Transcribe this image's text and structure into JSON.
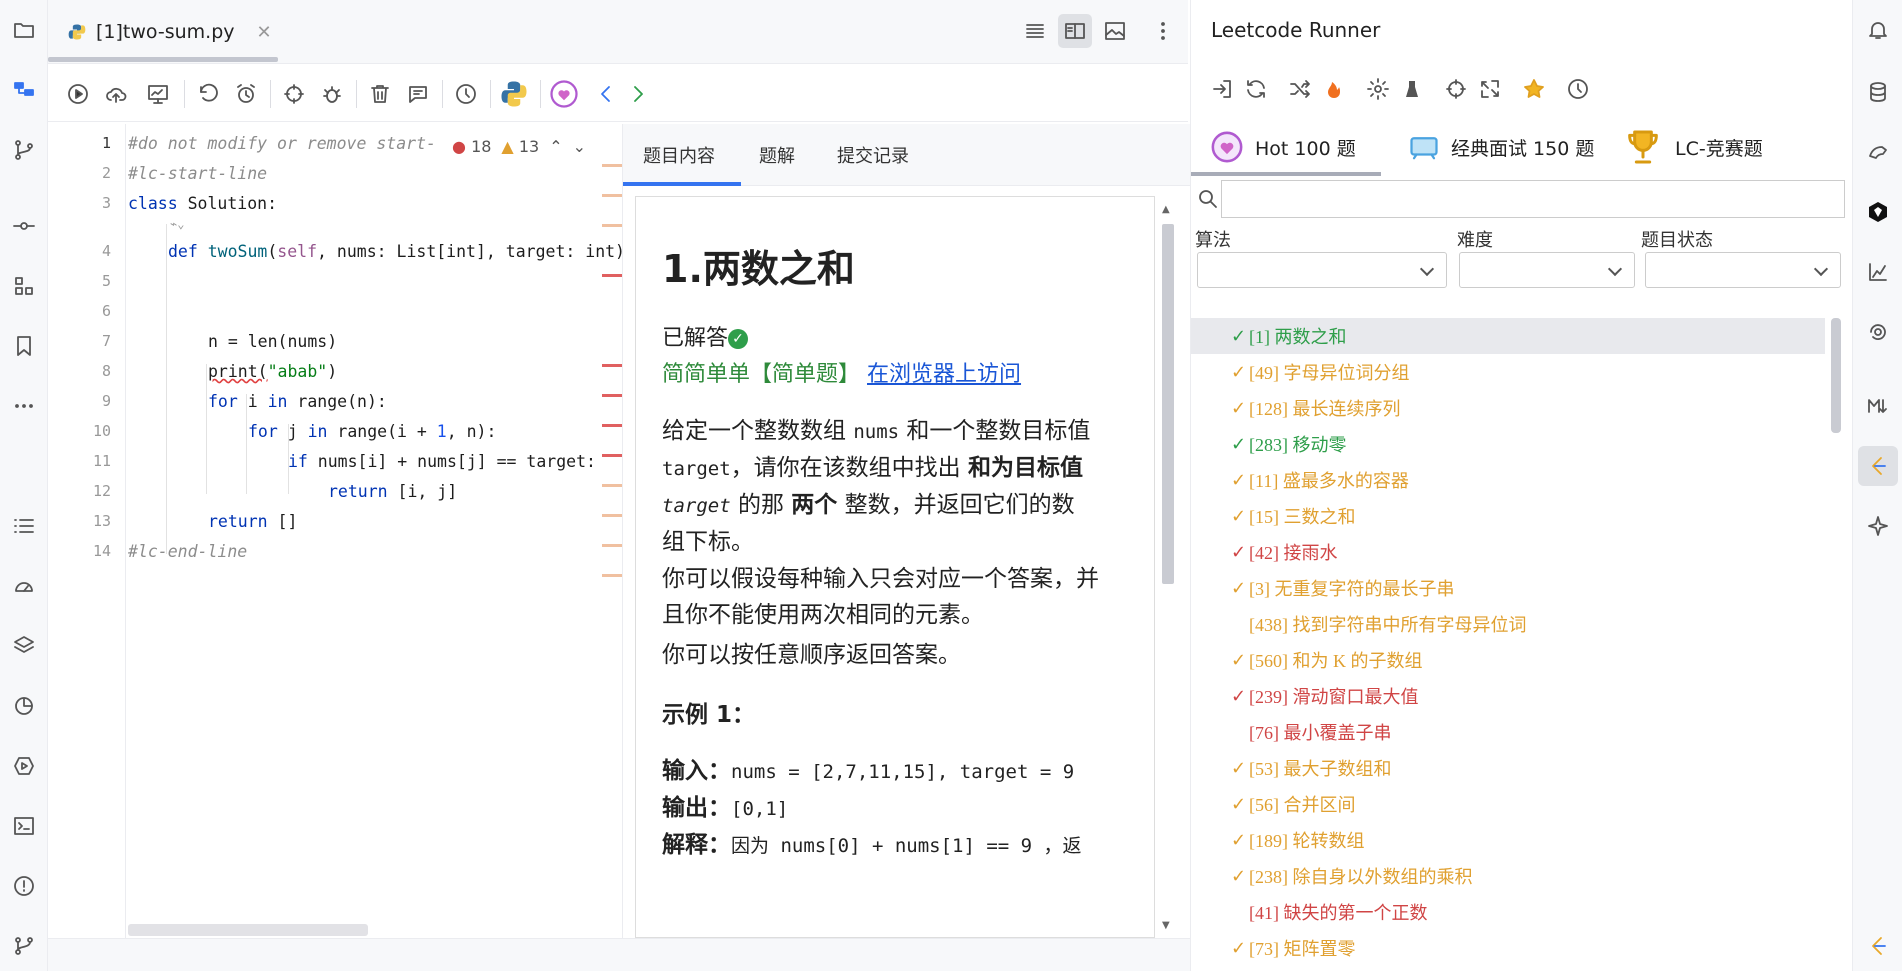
{
  "editor": {
    "tab_label": "[1]two-sum.py",
    "errors": "18",
    "warnings": "13",
    "lines": [
      {
        "n": "1"
      },
      {
        "n": "2"
      },
      {
        "n": "3"
      },
      {
        "n": "4"
      },
      {
        "n": "5"
      },
      {
        "n": "6"
      },
      {
        "n": "7"
      },
      {
        "n": "8"
      },
      {
        "n": "9"
      },
      {
        "n": "10"
      },
      {
        "n": "11"
      },
      {
        "n": "12"
      },
      {
        "n": "13"
      },
      {
        "n": "14"
      }
    ],
    "code": {
      "l1": "#do not modify or remove start-",
      "l2": "#lc-start-line",
      "l3a": "class",
      "l3b": " Solution:",
      "l4a": "def",
      "l4b": "twoSum",
      "l4c": "self",
      "l4d": ", nums: List[int], target: int)",
      "l7": "n = len(nums)",
      "l8a": "print(",
      "l8b": "\"abab\"",
      "l8c": ")",
      "l9a": "for",
      "l9b": " i ",
      "l9c": "in",
      "l9d": " range(n):",
      "l10a": "for",
      "l10b": " j ",
      "l10c": "in",
      "l10d": " range(i + ",
      "l10e": "1",
      "l10f": ", n):",
      "l11a": "if",
      "l11b": " nums[i] + nums[j] == target:",
      "l12a": "return",
      "l12b": " [i, j]",
      "l13a": "return",
      "l13b": " []",
      "l14": "#lc-end-line"
    }
  },
  "problem": {
    "tabs": [
      "题目内容",
      "题解",
      "提交记录"
    ],
    "title": "1.两数之和",
    "solved": "已解答",
    "difficulty": "简简单单【简单题】",
    "browser_link": "在浏览器上访问",
    "p1a": "给定一个整数数组 ",
    "p1b": "nums",
    "p1c": " 和一个整数目标值",
    "p1d": "target",
    "p1e": "，请你在该数组中找出 ",
    "p1f": "和为目标值",
    "p1g": "target",
    "p1h": " 的那 ",
    "p1i": "两个",
    "p1j": " 整数，并返回它们的数",
    "p1k": "组下标。",
    "p2a": "你可以假设每种输入只会对应一个答案，并",
    "p2b": "且你不能使用两次相同的元素。",
    "p3": "你可以按任意顺序返回答案。",
    "example_title": "示例 1：",
    "in_label": "输入：",
    "in_value": "nums = [2,7,11,15], target = 9",
    "out_label": "输出：",
    "out_value": "[0,1]",
    "exp_label": "解释：",
    "exp_value": "因为 nums[0] + nums[1] == 9 ，返"
  },
  "runner": {
    "title": "Leetcode Runner",
    "tabs": [
      "Hot 100 题",
      "经典面试 150 题",
      "LC-竞赛题"
    ],
    "filters": [
      "算法",
      "难度",
      "题目状态"
    ],
    "search_placeholder": "",
    "items": [
      {
        "check": "✓",
        "text": "[1] 两数之和",
        "level": "easy"
      },
      {
        "check": "✓",
        "text": "[49] 字母异位词分组",
        "level": "med"
      },
      {
        "check": "✓",
        "text": "[128] 最长连续序列",
        "level": "med"
      },
      {
        "check": "✓",
        "text": "[283] 移动零",
        "level": "easy"
      },
      {
        "check": "✓",
        "text": "[11] 盛最多水的容器",
        "level": "med"
      },
      {
        "check": "✓",
        "text": "[15] 三数之和",
        "level": "med"
      },
      {
        "check": "✓",
        "text": "[42] 接雨水",
        "level": "hard"
      },
      {
        "check": "✓",
        "text": "[3] 无重复字符的最长子串",
        "level": "med"
      },
      {
        "check": "",
        "text": "[438] 找到字符串中所有字母异位词",
        "level": "med"
      },
      {
        "check": "✓",
        "text": "[560] 和为 K 的子数组",
        "level": "med"
      },
      {
        "check": "✓",
        "text": "[239] 滑动窗口最大值",
        "level": "hard"
      },
      {
        "check": "",
        "text": "[76] 最小覆盖子串",
        "level": "hard"
      },
      {
        "check": "✓",
        "text": "[53] 最大子数组和",
        "level": "med"
      },
      {
        "check": "✓",
        "text": "[56] 合并区间",
        "level": "med"
      },
      {
        "check": "✓",
        "text": "[189] 轮转数组",
        "level": "med"
      },
      {
        "check": "✓",
        "text": "[238] 除自身以外数组的乘积",
        "level": "med"
      },
      {
        "check": "",
        "text": "[41] 缺失的第一个正数",
        "level": "hard"
      },
      {
        "check": "✓",
        "text": "[73] 矩阵置零",
        "level": "med"
      }
    ]
  },
  "colors": {
    "easy": "#2e9e4a",
    "medium": "#e0a030",
    "hard": "#d04545",
    "accent": "#3574f0"
  }
}
